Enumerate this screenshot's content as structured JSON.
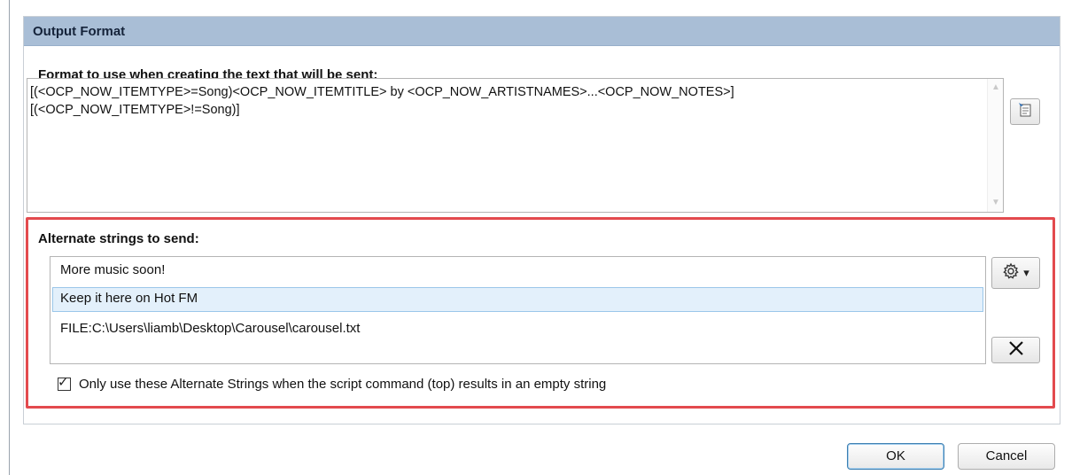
{
  "group": {
    "title": "Output Format"
  },
  "format_section": {
    "label": "Format to use when creating the text that will be sent:",
    "script_text": "[(<OCP_NOW_ITEMTYPE>=Song)<OCP_NOW_ITEMTITLE> by <OCP_NOW_ARTISTNAMES>...<OCP_NOW_NOTES>]\n[(<OCP_NOW_ITEMTYPE>!=Song)]",
    "script_button_icon": "script-editor-icon"
  },
  "alternate_section": {
    "label": "Alternate strings to send:",
    "items": [
      {
        "text": "More music soon!",
        "selected": false
      },
      {
        "text": "Keep it here on Hot FM",
        "selected": true
      },
      {
        "text": "FILE:C:\\Users\\liamb\\Desktop\\Carousel\\carousel.txt",
        "selected": false
      }
    ],
    "settings_button": {
      "icon": "gear-icon",
      "dropdown": "▾"
    },
    "delete_button": {
      "icon": "close-icon",
      "glyph": "✕"
    },
    "checkbox": {
      "checked": true,
      "label": "Only use these Alternate Strings when the script command (top) results in an empty string"
    }
  },
  "buttons": {
    "ok": "OK",
    "cancel": "Cancel"
  },
  "colors": {
    "header_bg": "#a9bed6",
    "highlight_border": "#e34a4e",
    "selected_row": "#e3f0fb"
  }
}
